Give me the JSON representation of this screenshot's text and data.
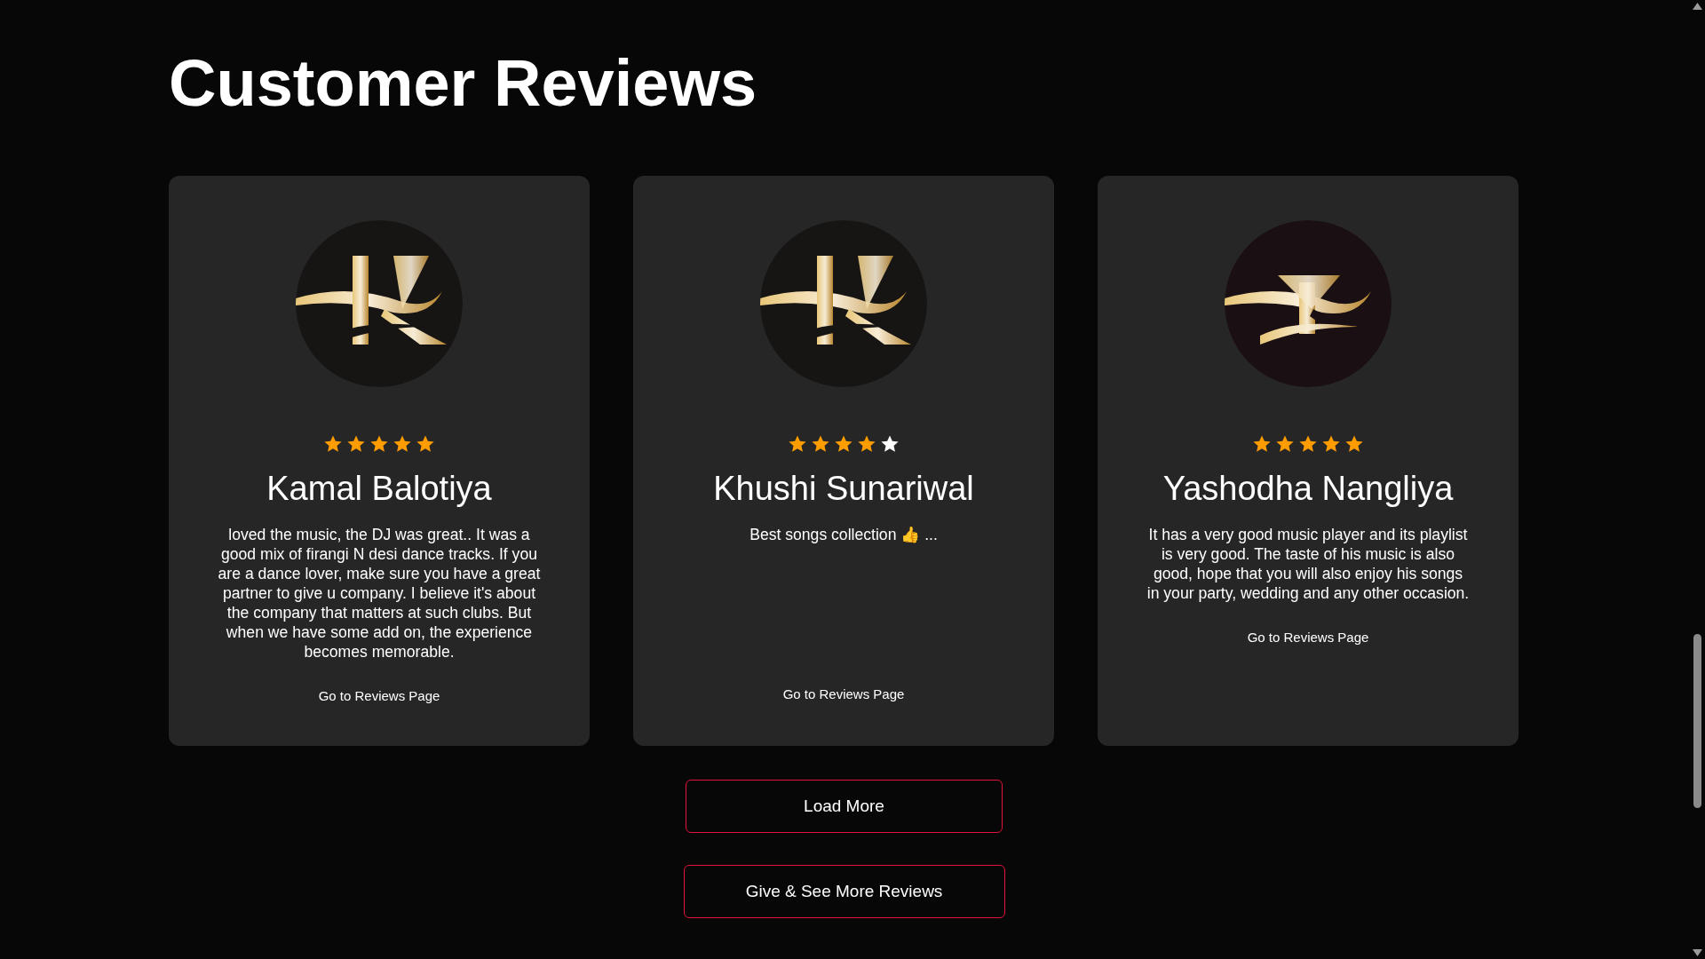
{
  "heading": "Customer Reviews",
  "reviews": [
    {
      "name": "Kamal Balotiya",
      "stars": 5,
      "text": "loved the music, the DJ was great.. It was a good mix of firangi N desi dance tracks. If you are a dance lover, make sure you have a great partner to give u company. I believe it's about the company that matters at such clubs. But when we have some add on, the experience becomes memorable.",
      "link": "Go to Reviews Page"
    },
    {
      "name": "Khushi Sunariwal",
      "stars": 4,
      "text": "Best songs collection 👍 ...",
      "link": "Go to Reviews Page"
    },
    {
      "name": "Yashodha Nangliya",
      "stars": 5,
      "text": "It has a very good music player and its playlist is very good. The taste of his music is also good, hope that you will also enjoy his songs in your party, wedding and any other occasion.",
      "link": "Go to Reviews Page"
    }
  ],
  "buttons": [
    "Load More",
    "Give & See More Reviews"
  ]
}
